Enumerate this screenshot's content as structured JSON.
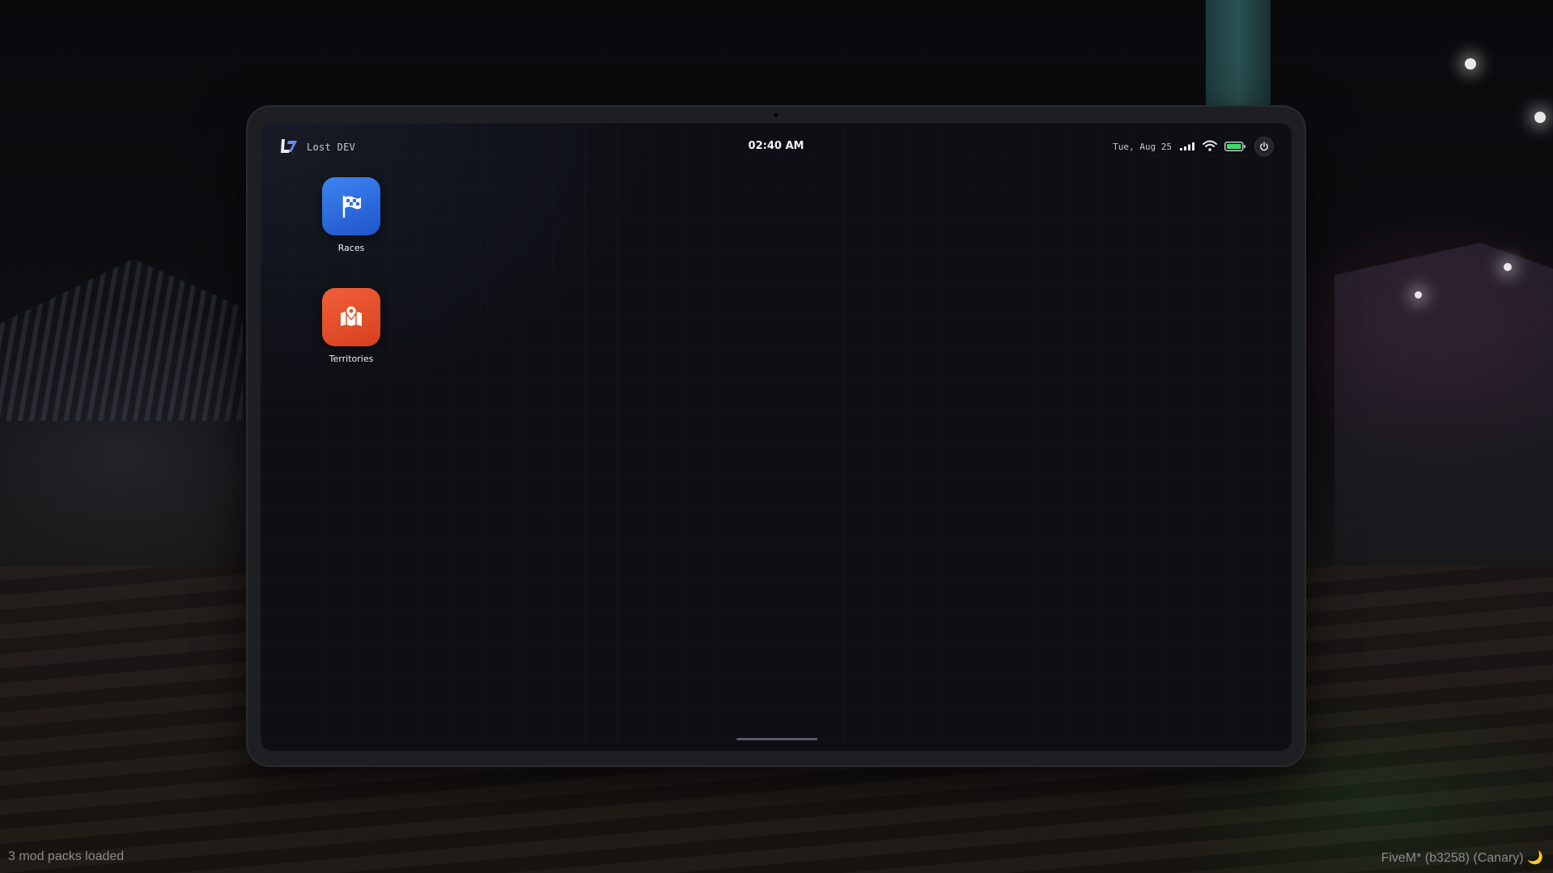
{
  "tablet": {
    "brand": "Lost DEV",
    "clock": "02:40 AM",
    "date": "Tue, Aug 25",
    "icons": {
      "logo": "lost-logo-icon",
      "signal": "cellular-signal-icon",
      "wifi": "wifi-icon",
      "battery": "battery-icon",
      "power": "power-icon"
    },
    "apps": [
      {
        "label": "Races",
        "icon": "checkered-flag-icon",
        "color": "#2f6fe0"
      },
      {
        "label": "Territories",
        "icon": "map-pin-icon",
        "color": "#e8502a"
      }
    ]
  },
  "footer": {
    "left": "3 mod packs loaded",
    "right": "FiveM* (b3258) (Canary) 🌙"
  },
  "colors": {
    "battery": "#3ddc6a",
    "screen": "#0d0f14",
    "frame": "#1e1f22"
  }
}
